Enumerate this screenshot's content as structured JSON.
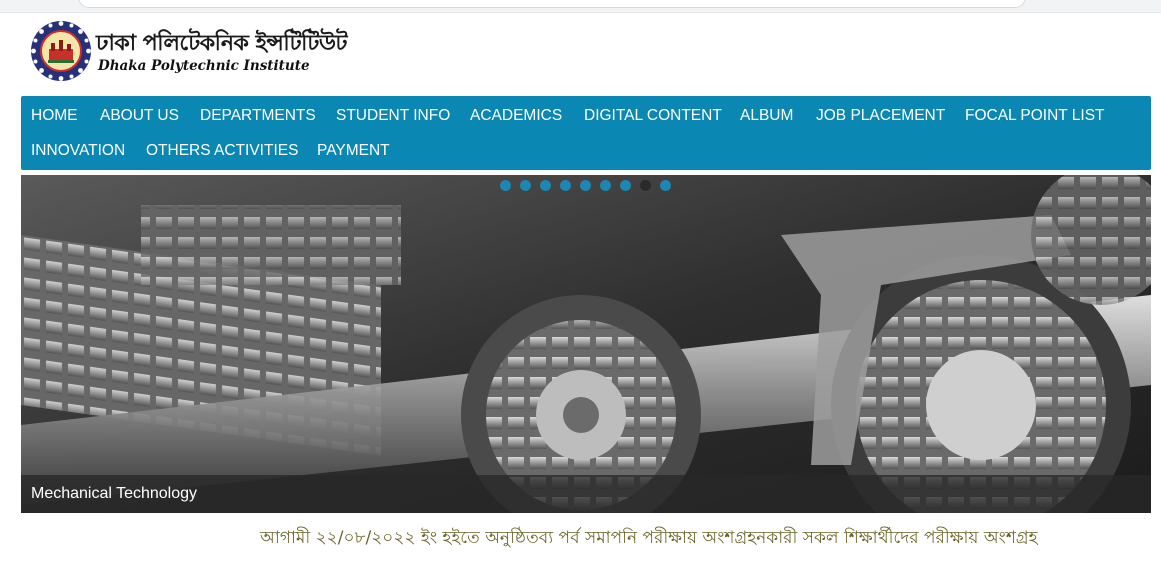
{
  "header": {
    "logo_title_bn": "ঢাকা পলিটেকনিক ইন্সটিটিউট",
    "logo_title_en": "Dhaka Polytechnic Institute"
  },
  "nav": {
    "items": [
      {
        "label": "HOME"
      },
      {
        "label": "ABOUT US"
      },
      {
        "label": "DEPARTMENTS"
      },
      {
        "label": "STUDENT INFO"
      },
      {
        "label": "ACADEMICS"
      },
      {
        "label": "DIGITAL CONTENT"
      },
      {
        "label": "ALBUM"
      },
      {
        "label": "JOB PLACEMENT"
      },
      {
        "label": "FOCAL POINT LIST"
      },
      {
        "label": "INNOVATION"
      },
      {
        "label": "OTHERS ACTIVITIES"
      },
      {
        "label": "PAYMENT"
      }
    ]
  },
  "slider": {
    "caption": "Mechanical Technology",
    "dot_count": 9
  },
  "notice": {
    "text": "আগামী ২২/০৮/২০২২ ইং হইতে অনুষ্ঠিতব্য পর্ব সমাপনি পরীক্ষায় অংশগ্রহনকারী সকল শিক্ষার্থীদের পরীক্ষায় অংশগ্রহ"
  },
  "colors": {
    "nav_bg": "#0a87b3",
    "dot": "#1b87b5",
    "notice_text": "#6a6428"
  }
}
